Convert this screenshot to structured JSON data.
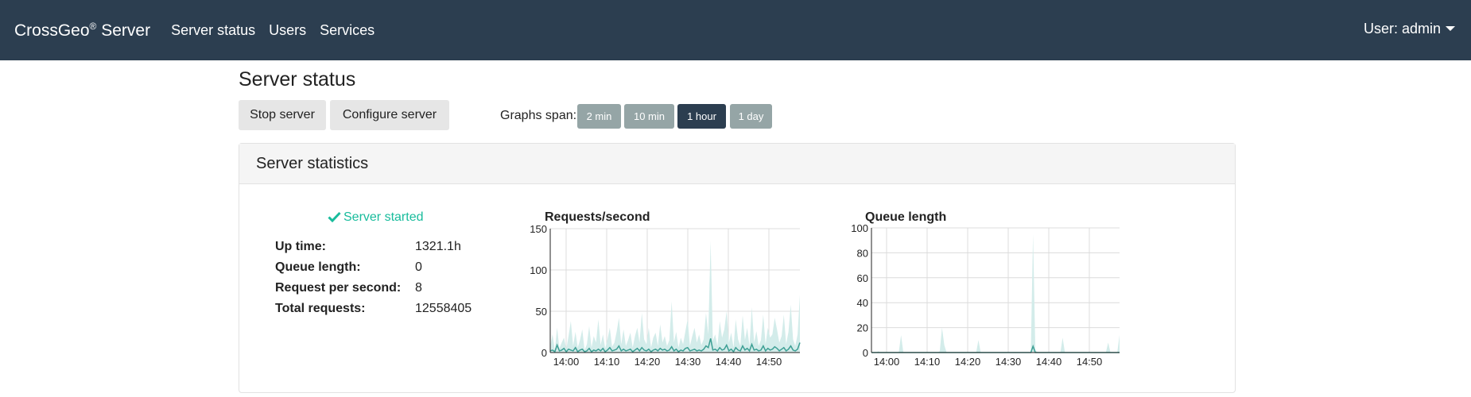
{
  "navbar": {
    "brand": "CrossGeo",
    "brand_mark": "®",
    "brand_suffix": " Server",
    "links": [
      "Server status",
      "Users",
      "Services"
    ],
    "user_menu": "User: admin",
    "bg_color": "#2c3e50"
  },
  "page": {
    "title": "Server status",
    "stop_button": "Stop server",
    "configure_button": "Configure server",
    "graphs_span_label": "Graphs span:",
    "spans": [
      {
        "label": "2 min",
        "active": false
      },
      {
        "label": "10 min",
        "active": false
      },
      {
        "label": "1 hour",
        "active": true
      },
      {
        "label": "1 day",
        "active": false
      }
    ]
  },
  "panel": {
    "title": "Server statistics",
    "status": "Server started",
    "status_icon": "check-icon",
    "status_color": "#18bc9c",
    "stats": [
      {
        "label": "Up time:",
        "value": "1321.1h"
      },
      {
        "label": "Queue length:",
        "value": "0"
      },
      {
        "label": "Request per second:",
        "value": "8"
      },
      {
        "label": "Total requests:",
        "value": "12558405"
      }
    ]
  },
  "chart_data": [
    {
      "type": "area",
      "title": "Requests/second",
      "x_ticks": [
        "14:00",
        "14:10",
        "14:20",
        "14:30",
        "14:40",
        "14:50"
      ],
      "y_ticks": [
        0,
        50,
        100,
        150
      ],
      "ylim": [
        0,
        150
      ],
      "grid": true,
      "fill_color": "#d3ecea",
      "line_color": "#3d9f94",
      "series": [
        {
          "values": [
            8,
            22,
            3,
            30,
            5,
            12,
            18,
            4,
            20,
            38,
            8,
            25,
            6,
            15,
            28,
            3,
            10,
            32,
            6,
            20,
            12,
            40,
            9,
            22,
            5,
            16,
            30,
            7,
            12,
            25,
            42,
            10,
            28,
            8,
            15,
            24,
            6,
            20,
            30,
            12,
            48,
            16,
            10,
            30,
            6,
            18,
            24,
            8,
            34,
            12,
            20,
            8,
            15,
            62,
            12,
            25,
            6,
            18,
            10,
            26,
            40,
            8,
            20,
            30,
            12,
            22,
            9,
            16,
            48,
            22,
            135,
            14,
            22,
            8,
            38,
            18,
            28,
            50,
            12,
            24,
            6,
            40,
            16,
            8,
            45,
            15,
            30,
            8,
            55,
            12,
            26,
            8,
            15,
            46,
            10,
            30,
            18,
            22,
            42,
            28,
            12,
            20,
            46,
            10,
            25,
            58,
            16,
            8,
            22,
            70
          ]
        },
        {
          "values": [
            2,
            3,
            1,
            9,
            2,
            3,
            5,
            1,
            4,
            3,
            2,
            6,
            1,
            3,
            4,
            1,
            2,
            5,
            1,
            3,
            2,
            4,
            2,
            5,
            1,
            3,
            6,
            2,
            3,
            4,
            8,
            2,
            4,
            2,
            3,
            4,
            1,
            3,
            5,
            2,
            6,
            3,
            2,
            4,
            1,
            3,
            4,
            2,
            5,
            3,
            4,
            2,
            3,
            7,
            2,
            4,
            1,
            3,
            2,
            5,
            6,
            2,
            3,
            4,
            2,
            3,
            2,
            4,
            8,
            6,
            17,
            3,
            4,
            2,
            6,
            3,
            4,
            9,
            2,
            4,
            1,
            6,
            3,
            2,
            8,
            3,
            5,
            2,
            10,
            3,
            4,
            2,
            3,
            8,
            2,
            5,
            3,
            4,
            7,
            5,
            2,
            4,
            6,
            2,
            4,
            8,
            3,
            2,
            4,
            12
          ]
        }
      ]
    },
    {
      "type": "area",
      "title": "Queue length",
      "x_ticks": [
        "14:00",
        "14:10",
        "14:20",
        "14:30",
        "14:40",
        "14:50"
      ],
      "y_ticks": [
        0,
        20,
        40,
        60,
        80,
        100
      ],
      "ylim": [
        0,
        100
      ],
      "grid": true,
      "fill_color": "#d3ecea",
      "line_color": "#3d9f94",
      "series": [
        {
          "values": [
            0,
            0,
            0,
            1,
            0,
            0,
            0,
            0,
            0,
            0,
            0,
            0,
            0,
            14,
            0,
            0,
            0,
            0,
            0,
            0,
            0,
            0,
            0,
            0,
            0,
            0,
            0,
            0,
            0,
            0,
            1,
            20,
            6,
            0,
            0,
            0,
            0,
            0,
            0,
            0,
            0,
            0,
            0,
            0,
            0,
            0,
            0,
            10,
            0,
            0,
            0,
            0,
            0,
            0,
            0,
            0,
            0,
            0,
            0,
            0,
            0,
            0,
            0,
            0,
            0,
            0,
            0,
            0,
            0,
            0,
            0,
            95,
            2,
            0,
            0,
            0,
            0,
            0,
            0,
            0,
            0,
            0,
            0,
            0,
            12,
            0,
            0,
            0,
            0,
            0,
            0,
            0,
            0,
            0,
            0,
            0,
            0,
            0,
            0,
            0,
            0,
            0,
            0,
            0,
            8,
            0,
            0,
            0,
            0,
            14
          ]
        },
        {
          "values": [
            0,
            0,
            0,
            0,
            0,
            0,
            0,
            0,
            0,
            0,
            0,
            0,
            0,
            0,
            0,
            0,
            0,
            0,
            0,
            0,
            0,
            0,
            0,
            0,
            0,
            0,
            0,
            0,
            0,
            0,
            0,
            0,
            0,
            0,
            0,
            0,
            0,
            0,
            0,
            0,
            0,
            0,
            0,
            0,
            0,
            0,
            0,
            0,
            0,
            0,
            0,
            0,
            0,
            0,
            0,
            0,
            0,
            0,
            0,
            0,
            0,
            0,
            0,
            0,
            0,
            0,
            0,
            0,
            0,
            0,
            0,
            5,
            0,
            0,
            0,
            0,
            0,
            0,
            0,
            0,
            0,
            0,
            0,
            0,
            0,
            0,
            0,
            0,
            0,
            0,
            0,
            0,
            0,
            0,
            0,
            0,
            0,
            0,
            0,
            0,
            0,
            0,
            0,
            0,
            0,
            0,
            0,
            0,
            0,
            0
          ]
        }
      ]
    }
  ]
}
